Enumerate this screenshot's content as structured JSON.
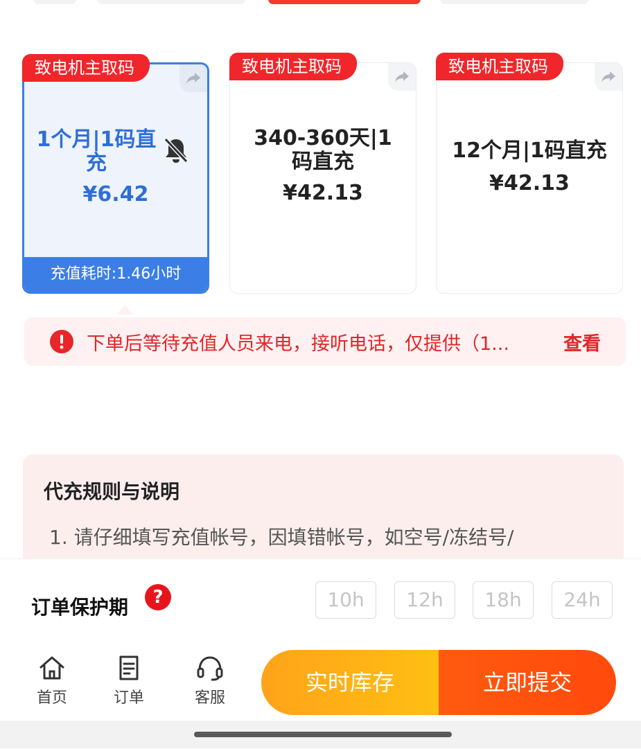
{
  "products": [
    {
      "tag": "致电机主取码",
      "title": "1个月|1码直充",
      "price": "¥6.42",
      "footer": "充值耗时:1.46小时",
      "selected": true
    },
    {
      "tag": "致电机主取码",
      "title": "340-360天|1码直充",
      "price": "¥42.13",
      "selected": false
    },
    {
      "tag": "致电机主取码",
      "title": "12个月|1码直充",
      "price": "¥42.13",
      "selected": false
    }
  ],
  "notice": {
    "text": "下单后等待充值人员来电，接听电话，仅提供（1...",
    "more_label": "查看",
    "color": "#e0262a"
  },
  "rules": {
    "title": "代充规则与说明",
    "line1": "1. 请仔细填写充值帐号，因填错帐号，如空号/冻结号/"
  },
  "protection": {
    "label": "订单保护期",
    "help_icon_text": "?",
    "options": [
      "10h",
      "12h",
      "18h",
      "24h"
    ]
  },
  "nav": {
    "home": "首页",
    "orders": "订单",
    "service": "客服"
  },
  "actions": {
    "stock_label": "实时库存",
    "submit_label": "立即提交"
  },
  "colors": {
    "accent_blue": "#3b7fe6",
    "tag_red": "#f0262a",
    "stock_orange": "#ffb016",
    "submit_orange": "#ff520e"
  }
}
